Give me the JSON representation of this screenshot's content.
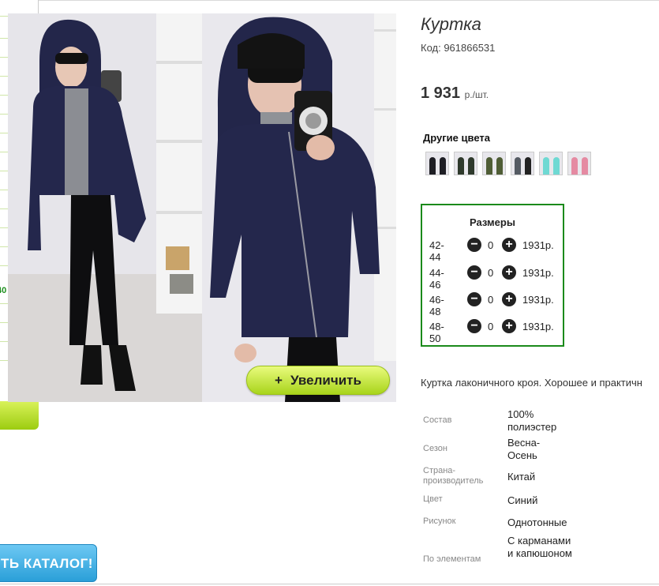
{
  "sidebar": {
    "fragment_text": "40",
    "catalog_button": "ТЬ КАТАЛОГ!"
  },
  "gallery": {
    "zoom_button_label": "Увеличить",
    "zoom_icon": "+"
  },
  "product": {
    "title": "Куртка",
    "code": "Код: 961866531",
    "price": "1 931",
    "price_unit": "р./шт.",
    "other_colors_title": "Другие цвета",
    "color_swatches": [
      "black",
      "dark-green",
      "olive",
      "grey",
      "mint",
      "pink"
    ],
    "sizes_title": "Размеры",
    "sizes": [
      {
        "label": "42-44",
        "qty": "0",
        "price": "1931р."
      },
      {
        "label": "44-46",
        "qty": "0",
        "price": "1931р."
      },
      {
        "label": "46-48",
        "qty": "0",
        "price": "1931р."
      },
      {
        "label": "48-50",
        "qty": "0",
        "price": "1931р."
      }
    ],
    "description": "Куртка лаконичного кроя. Хорошее и практичн",
    "specs": [
      {
        "label": "Состав",
        "value": "100% полиэстер"
      },
      {
        "label": "Сезон",
        "value": "Весна-Осень"
      },
      {
        "label": "Страна-производитель",
        "value": "Китай"
      },
      {
        "label": "Цвет",
        "value": "Синий"
      },
      {
        "label": "Рисунок",
        "value": "Однотонные"
      },
      {
        "label": "По элементам",
        "value": "С карманами и капюшоном"
      }
    ]
  },
  "colors": {
    "accent_green": "#1b8a1b",
    "button_green": "#a8d41b",
    "catalog_blue": "#2a9fd8",
    "jacket_navy": "#23264a"
  }
}
